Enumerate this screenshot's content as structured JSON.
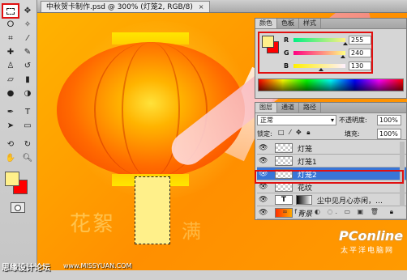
{
  "document": {
    "tab_title": "中秋贺卡制作.psd @ 300% (灯笼2, RGB/8)",
    "close_glyph": "×"
  },
  "toolbox": {
    "foreground_color": "#fff08a",
    "background_color": "#ff0000",
    "tools": [
      {
        "name": "rect-marquee-icon",
        "glyph": ""
      },
      {
        "name": "move-icon",
        "glyph": "✥"
      },
      {
        "name": "lasso-icon",
        "glyph": "ⵔ"
      },
      {
        "name": "magic-wand-icon",
        "glyph": "✧"
      },
      {
        "name": "crop-icon",
        "glyph": "⌗"
      },
      {
        "name": "eyedropper-icon",
        "glyph": "⁄"
      },
      {
        "name": "healing-brush-icon",
        "glyph": "✚"
      },
      {
        "name": "brush-icon",
        "glyph": "✎"
      },
      {
        "name": "clone-stamp-icon",
        "glyph": "♙"
      },
      {
        "name": "history-brush-icon",
        "glyph": "↺"
      },
      {
        "name": "eraser-icon",
        "glyph": "▱"
      },
      {
        "name": "gradient-icon",
        "glyph": "▮"
      },
      {
        "name": "blur-icon",
        "glyph": "●"
      },
      {
        "name": "dodge-icon",
        "glyph": "◑"
      },
      {
        "name": "pen-icon",
        "glyph": "✒"
      },
      {
        "name": "type-icon",
        "glyph": "T"
      },
      {
        "name": "path-select-icon",
        "glyph": "➤"
      },
      {
        "name": "shape-icon",
        "glyph": "▭"
      },
      {
        "name": "3d-rotate-icon",
        "glyph": "⟲"
      },
      {
        "name": "3d-orbit-icon",
        "glyph": "↻"
      },
      {
        "name": "hand-icon",
        "glyph": "✋"
      },
      {
        "name": "zoom-icon",
        "glyph": "🔍︎"
      }
    ]
  },
  "color_panel": {
    "tabs": [
      "颜色",
      "色板",
      "样式"
    ],
    "active_tab": 0,
    "channels": [
      {
        "label": "R",
        "value": "255",
        "color": "#ff0000"
      },
      {
        "label": "G",
        "value": "240",
        "color": "#00c000"
      },
      {
        "label": "B",
        "value": "130",
        "color": "#0000ff"
      }
    ]
  },
  "layers_panel": {
    "tabs": [
      "图层",
      "通道",
      "路径"
    ],
    "active_tab": 0,
    "blend_mode": "正常",
    "opacity_label": "不透明度:",
    "opacity_value": "100%",
    "lock_label": "锁定:",
    "lock_icons": "□ ⁄ ✥ 🔒︎",
    "fill_label": "填充:",
    "fill_value": "100%",
    "layers": [
      {
        "name": "灯笼",
        "selected": false
      },
      {
        "name": "灯笼1",
        "selected": false
      },
      {
        "name": "灯笼2",
        "selected": true
      },
      {
        "name": "花纹",
        "selected": false
      },
      {
        "name": "尘中见月心亦闲，…",
        "selected": false,
        "type": "text"
      },
      {
        "name": "背景",
        "selected": false,
        "type": "background"
      }
    ],
    "footer_icons": "∞ fx. ◐ ◌. ▭ ▣ 🗑"
  },
  "canvas_art": {
    "seal_left": "花絮",
    "seal_right": "满"
  },
  "watermarks": {
    "left": "思缘设计论坛",
    "left_url": "www.MISSYUAN.COM",
    "right": "PConline",
    "right_sub": "太平洋电脑网"
  }
}
